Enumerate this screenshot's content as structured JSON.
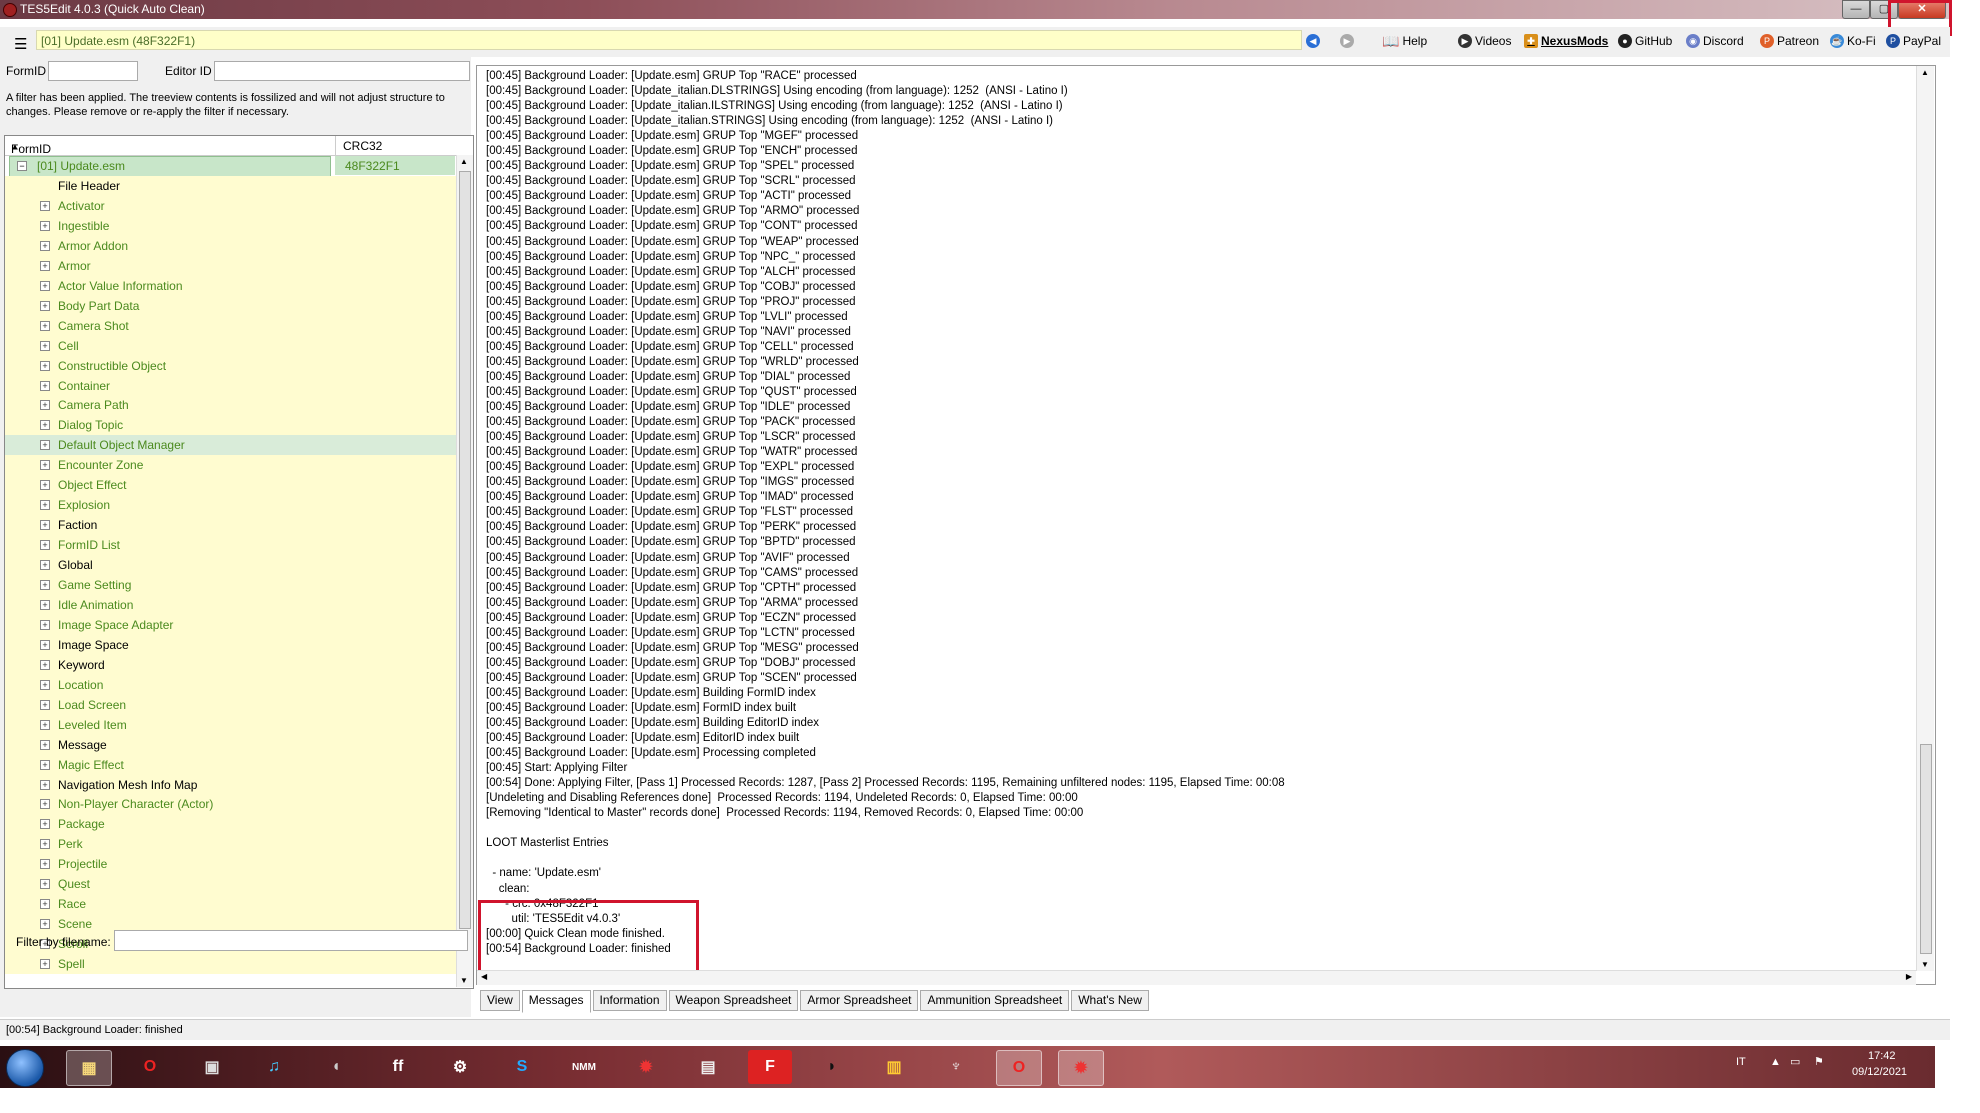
{
  "window": {
    "title": "TES5Edit 4.0.3 (Quick Auto Clean)",
    "minimize": "—",
    "maximize": "▢",
    "close": "✕"
  },
  "toolbar": {
    "path": "[01] Update.esm (48F322F1)",
    "links": [
      "Help",
      "Videos",
      "NexusMods",
      "GitHub",
      "Discord",
      "Patreon",
      "Ko-Fi",
      "PayPal"
    ]
  },
  "left": {
    "formid_label": "FormID",
    "editorid_label": "Editor ID",
    "filter_note": "A filter has been applied. The treeview contents is fossilized and will not adjust structure to changes.  Please remove or re-apply the filter if necessary.",
    "columns": [
      "FormID",
      "CRC32"
    ],
    "root": {
      "name": "[01] Update.esm",
      "crc": "48F322F1"
    },
    "items": [
      "File Header",
      "Activator",
      "Ingestible",
      "Armor Addon",
      "Armor",
      "Actor Value Information",
      "Body Part Data",
      "Camera Shot",
      "Cell",
      "Constructible Object",
      "Container",
      "Camera Path",
      "Dialog Topic",
      "Default Object Manager",
      "Encounter Zone",
      "Object Effect",
      "Explosion",
      "Faction",
      "FormID List",
      "Global",
      "Game Setting",
      "Idle Animation",
      "Image Space Adapter",
      "Image Space",
      "Keyword",
      "Location",
      "Load Screen",
      "Leveled Item",
      "Message",
      "Magic Effect",
      "Navigation Mesh Info Map",
      "Non-Player Character (Actor)",
      "Package",
      "Perk",
      "Projectile",
      "Quest",
      "Race",
      "Scene",
      "Scroll",
      "Spell"
    ],
    "filter_label": "Filter by filename:"
  },
  "messages": [
    "[00:45] Background Loader: [Update.esm] GRUP Top \"RACE\" processed",
    "[00:45] Background Loader: [Update_italian.DLSTRINGS] Using encoding (from language): 1252  (ANSI - Latino I)",
    "[00:45] Background Loader: [Update_italian.ILSTRINGS] Using encoding (from language): 1252  (ANSI - Latino I)",
    "[00:45] Background Loader: [Update_italian.STRINGS] Using encoding (from language): 1252  (ANSI - Latino I)",
    "[00:45] Background Loader: [Update.esm] GRUP Top \"MGEF\" processed",
    "[00:45] Background Loader: [Update.esm] GRUP Top \"ENCH\" processed",
    "[00:45] Background Loader: [Update.esm] GRUP Top \"SPEL\" processed",
    "[00:45] Background Loader: [Update.esm] GRUP Top \"SCRL\" processed",
    "[00:45] Background Loader: [Update.esm] GRUP Top \"ACTI\" processed",
    "[00:45] Background Loader: [Update.esm] GRUP Top \"ARMO\" processed",
    "[00:45] Background Loader: [Update.esm] GRUP Top \"CONT\" processed",
    "[00:45] Background Loader: [Update.esm] GRUP Top \"WEAP\" processed",
    "[00:45] Background Loader: [Update.esm] GRUP Top \"NPC_\" processed",
    "[00:45] Background Loader: [Update.esm] GRUP Top \"ALCH\" processed",
    "[00:45] Background Loader: [Update.esm] GRUP Top \"COBJ\" processed",
    "[00:45] Background Loader: [Update.esm] GRUP Top \"PROJ\" processed",
    "[00:45] Background Loader: [Update.esm] GRUP Top \"LVLI\" processed",
    "[00:45] Background Loader: [Update.esm] GRUP Top \"NAVI\" processed",
    "[00:45] Background Loader: [Update.esm] GRUP Top \"CELL\" processed",
    "[00:45] Background Loader: [Update.esm] GRUP Top \"WRLD\" processed",
    "[00:45] Background Loader: [Update.esm] GRUP Top \"DIAL\" processed",
    "[00:45] Background Loader: [Update.esm] GRUP Top \"QUST\" processed",
    "[00:45] Background Loader: [Update.esm] GRUP Top \"IDLE\" processed",
    "[00:45] Background Loader: [Update.esm] GRUP Top \"PACK\" processed",
    "[00:45] Background Loader: [Update.esm] GRUP Top \"LSCR\" processed",
    "[00:45] Background Loader: [Update.esm] GRUP Top \"WATR\" processed",
    "[00:45] Background Loader: [Update.esm] GRUP Top \"EXPL\" processed",
    "[00:45] Background Loader: [Update.esm] GRUP Top \"IMGS\" processed",
    "[00:45] Background Loader: [Update.esm] GRUP Top \"IMAD\" processed",
    "[00:45] Background Loader: [Update.esm] GRUP Top \"FLST\" processed",
    "[00:45] Background Loader: [Update.esm] GRUP Top \"PERK\" processed",
    "[00:45] Background Loader: [Update.esm] GRUP Top \"BPTD\" processed",
    "[00:45] Background Loader: [Update.esm] GRUP Top \"AVIF\" processed",
    "[00:45] Background Loader: [Update.esm] GRUP Top \"CAMS\" processed",
    "[00:45] Background Loader: [Update.esm] GRUP Top \"CPTH\" processed",
    "[00:45] Background Loader: [Update.esm] GRUP Top \"ARMA\" processed",
    "[00:45] Background Loader: [Update.esm] GRUP Top \"ECZN\" processed",
    "[00:45] Background Loader: [Update.esm] GRUP Top \"LCTN\" processed",
    "[00:45] Background Loader: [Update.esm] GRUP Top \"MESG\" processed",
    "[00:45] Background Loader: [Update.esm] GRUP Top \"DOBJ\" processed",
    "[00:45] Background Loader: [Update.esm] GRUP Top \"SCEN\" processed",
    "[00:45] Background Loader: [Update.esm] Building FormID index",
    "[00:45] Background Loader: [Update.esm] FormID index built",
    "[00:45] Background Loader: [Update.esm] Building EditorID index",
    "[00:45] Background Loader: [Update.esm] EditorID index built",
    "[00:45] Background Loader: [Update.esm] Processing completed",
    "[00:45] Start: Applying Filter",
    "[00:54] Done: Applying Filter, [Pass 1] Processed Records: 1287, [Pass 2] Processed Records: 1195, Remaining unfiltered nodes: 1195, Elapsed Time: 00:08",
    "[Undeleting and Disabling References done]  Processed Records: 1194, Undeleted Records: 0, Elapsed Time: 00:00",
    "[Removing \"Identical to Master\" records done]  Processed Records: 1194, Removed Records: 0, Elapsed Time: 00:00",
    "",
    "LOOT Masterlist Entries",
    "",
    "  - name: 'Update.esm'",
    "    clean:",
    "      - crc: 0x48F322F1",
    "        util: 'TES5Edit v4.0.3'",
    "[00:00] Quick Clean mode finished.",
    "[00:54] Background Loader: finished"
  ],
  "tabs": [
    "View",
    "Messages",
    "Information",
    "Weapon Spreadsheet",
    "Armor Spreadsheet",
    "Ammunition Spreadsheet",
    "What's New"
  ],
  "active_tab": "Messages",
  "status": "[00:54] Background Loader: finished",
  "taskbar": {
    "language": "IT",
    "time": "17:42",
    "date": "09/12/2021"
  },
  "colors": {
    "accent_highlight": "#d0142d",
    "tree_text": "#4b8a1e",
    "tree_row": "#fffcd0"
  }
}
